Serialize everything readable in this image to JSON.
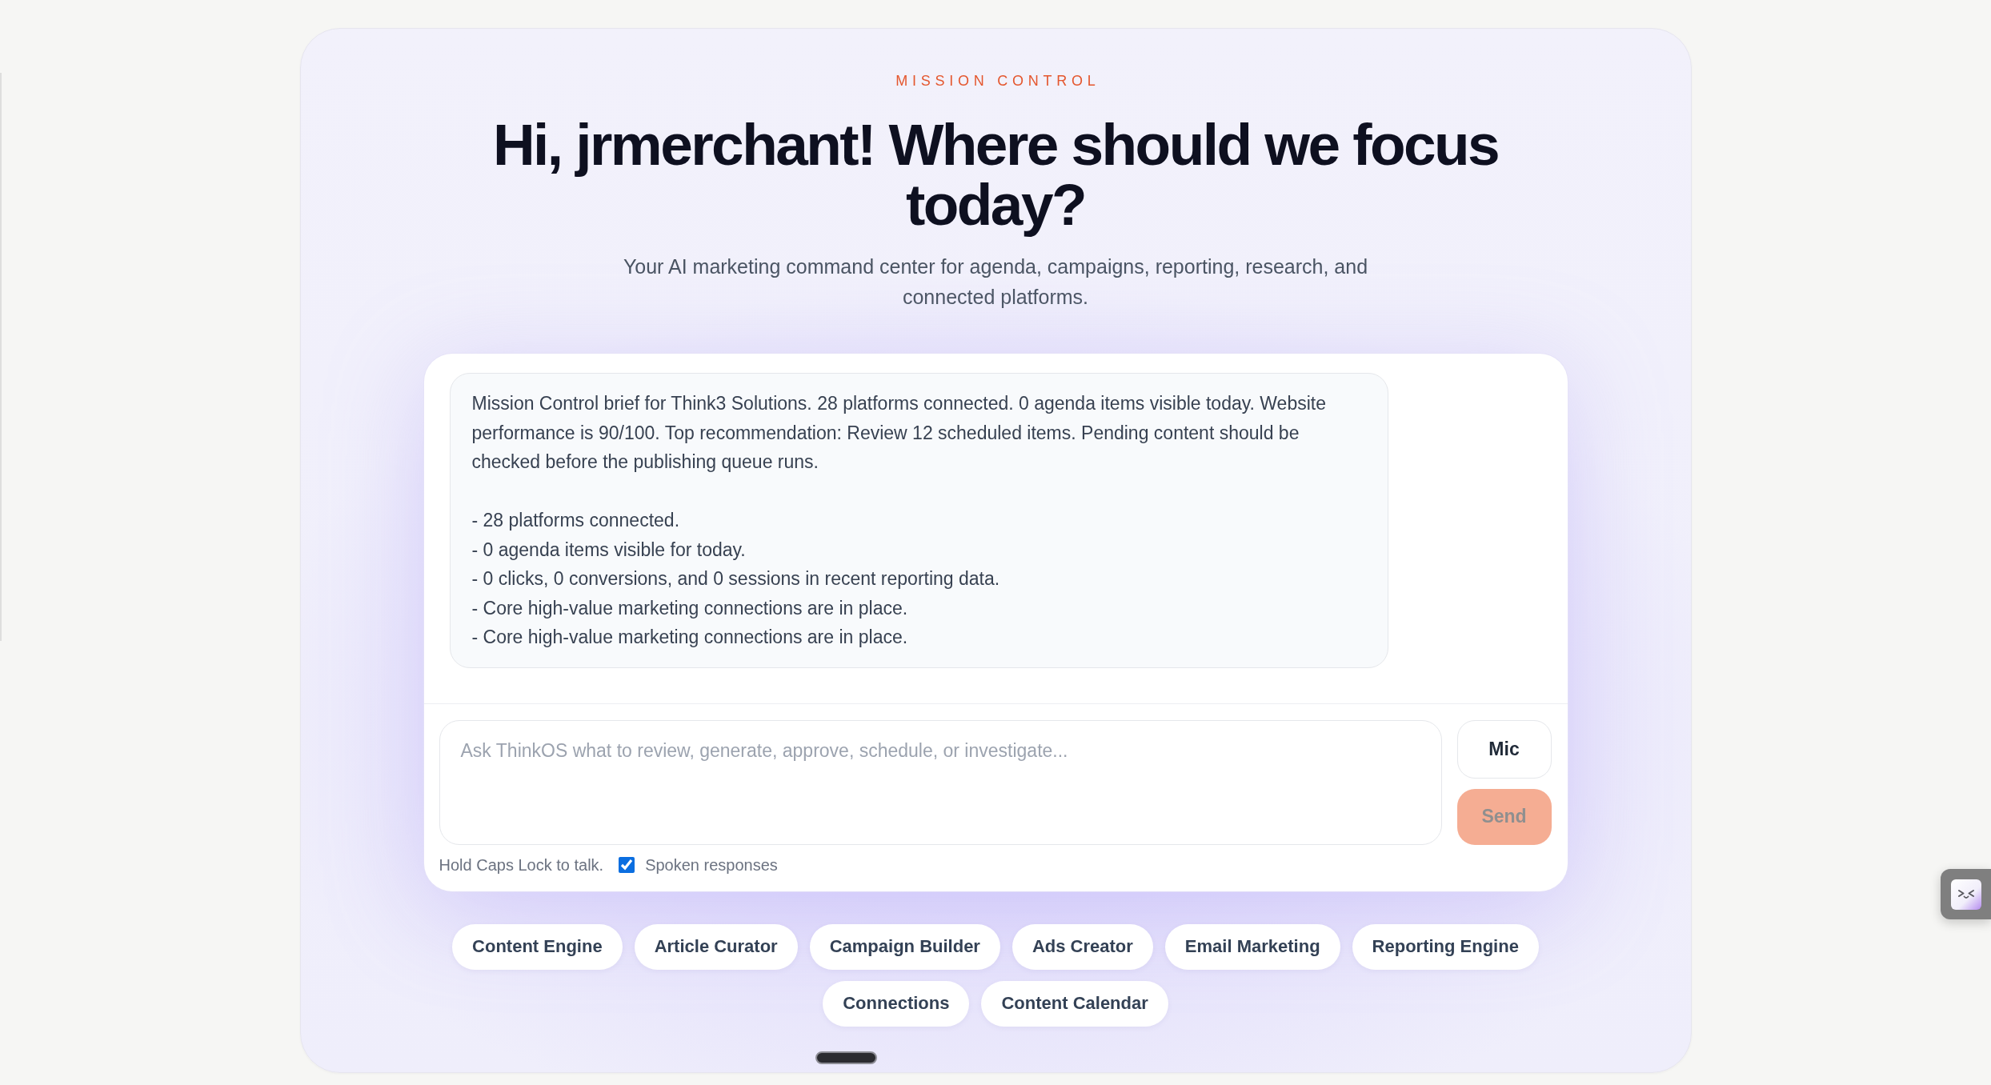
{
  "header": {
    "eyebrow": "MISSION CONTROL",
    "title": "Hi, jrmerchant! Where should we focus today?",
    "subtitle": "Your AI marketing command center for agenda, campaigns, reporting, research, and connected platforms."
  },
  "messages": [
    {
      "kind": "assistant",
      "summary": "Mission Control brief for Think3 Solutions. 28 platforms connected. 0 agenda items visible today. Website performance is 90/100. Top recommendation: Review 12 scheduled items. Pending content should be checked before the publishing queue runs.",
      "bullets": [
        "- 28 platforms connected.",
        "- 0 agenda items visible for today.",
        "- 0 clicks, 0 conversions, and 0 sessions in recent reporting data.",
        "- Core high-value marketing connections are in place.",
        "- Core high-value marketing connections are in place."
      ]
    }
  ],
  "composer": {
    "placeholder": "Ask ThinkOS what to review, generate, approve, schedule, or investigate...",
    "buttons": [
      {
        "kind": "mic",
        "label": "Mic",
        "disabled": false
      },
      {
        "kind": "send",
        "label": "Send",
        "disabled": true
      }
    ],
    "hint": "Hold Caps Lock to talk.",
    "spoken_responses": {
      "label": "Spoken responses",
      "checked": true
    }
  },
  "shortcuts": [
    "Content Engine",
    "Article Curator",
    "Campaign Builder",
    "Ads Creator",
    "Email Marketing",
    "Reporting Engine",
    "Connections",
    "Content Calendar"
  ]
}
